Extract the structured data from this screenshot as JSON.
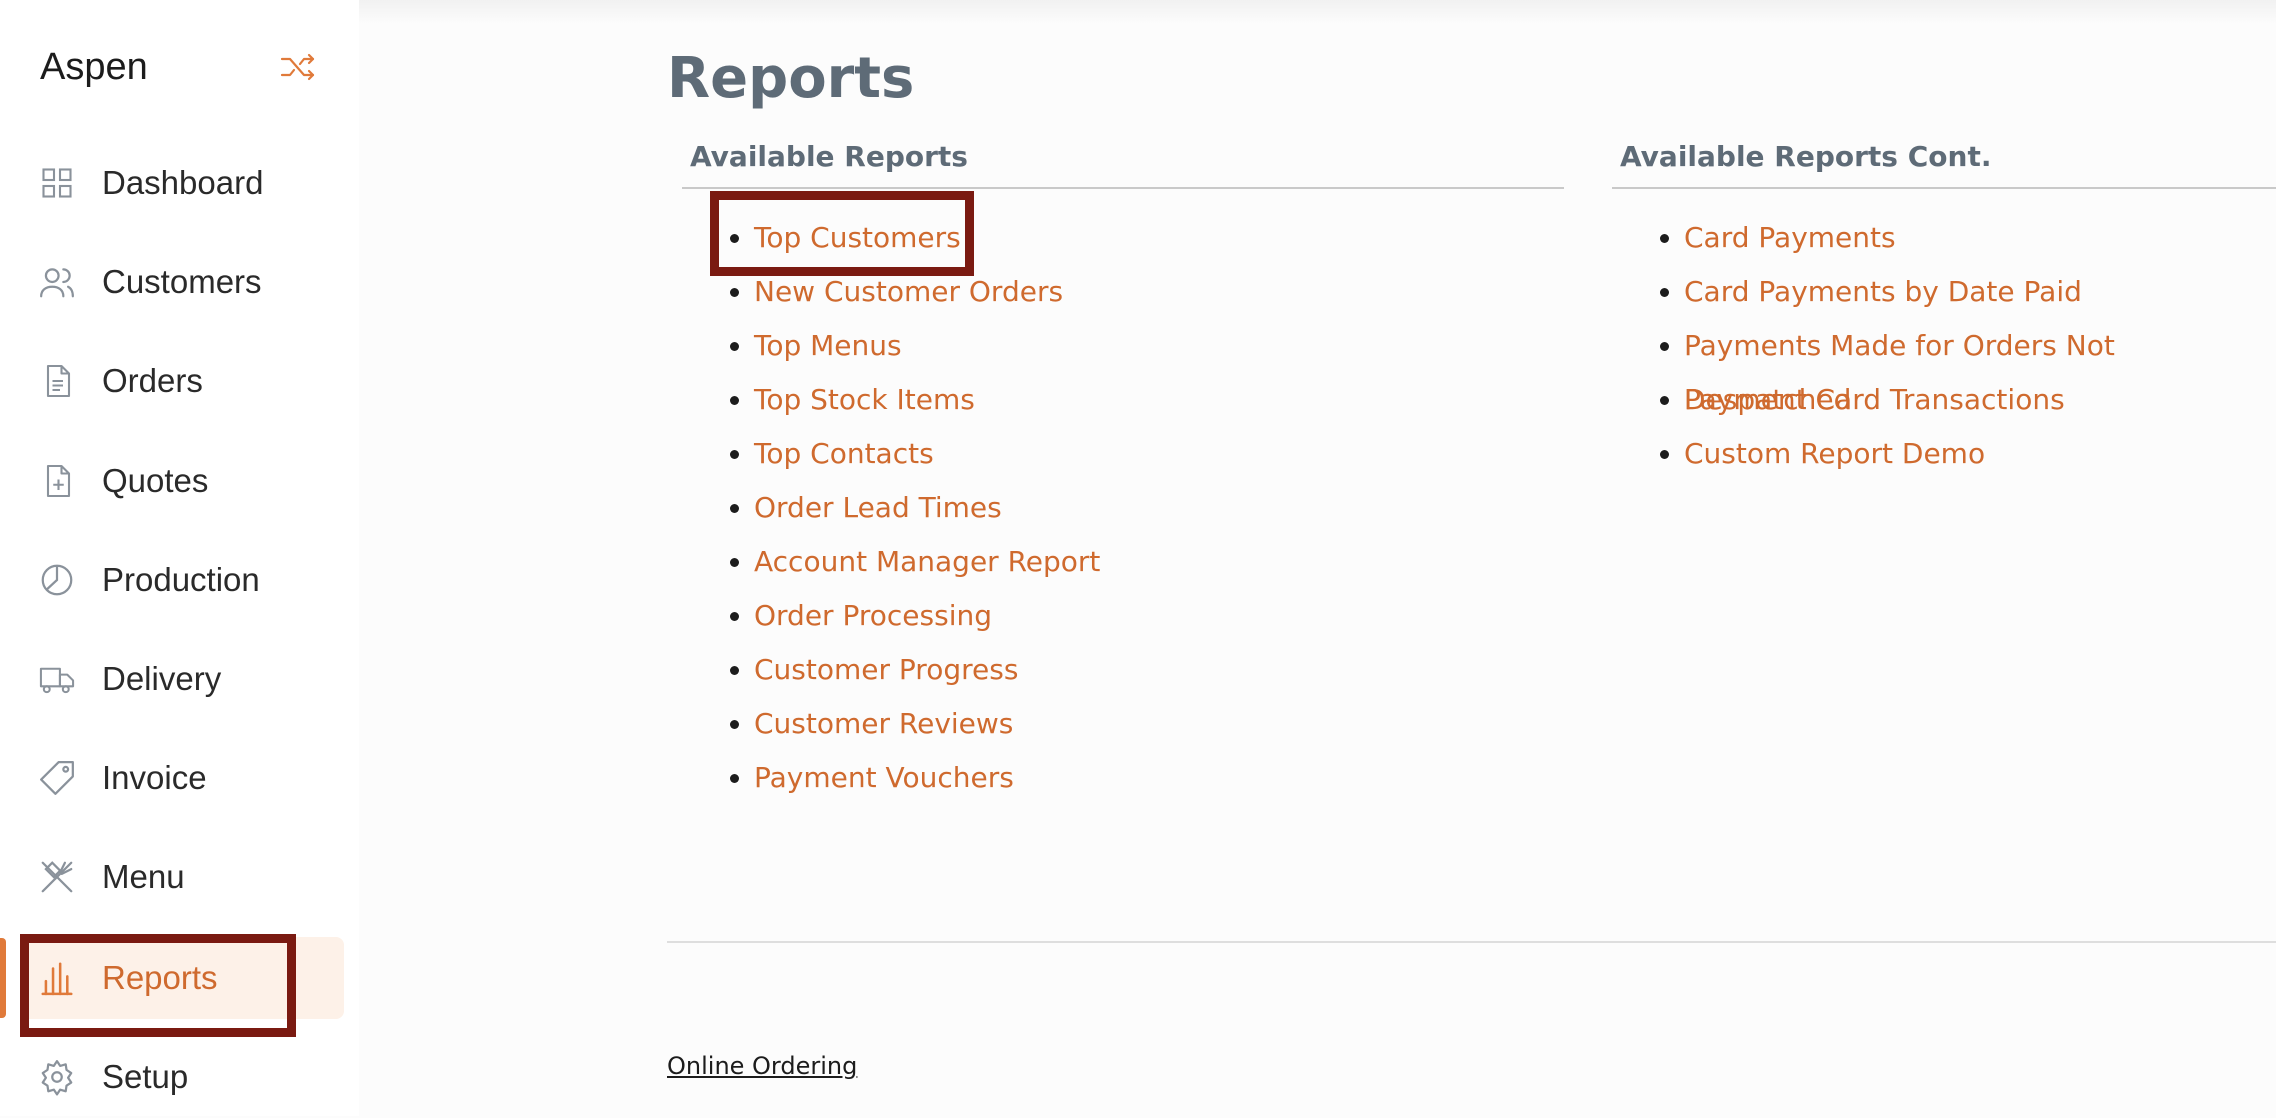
{
  "sidebar": {
    "brand": "Aspen",
    "items": [
      {
        "label": "Dashboard",
        "icon": "grid-icon"
      },
      {
        "label": "Customers",
        "icon": "users-icon"
      },
      {
        "label": "Orders",
        "icon": "document-icon"
      },
      {
        "label": "Quotes",
        "icon": "document-plus-icon"
      },
      {
        "label": "Production",
        "icon": "pie-chart-icon"
      },
      {
        "label": "Delivery",
        "icon": "truck-icon"
      },
      {
        "label": "Invoice",
        "icon": "tag-icon"
      },
      {
        "label": "Menu",
        "icon": "utensils-icon"
      },
      {
        "label": "Reports",
        "icon": "bar-chart-icon",
        "active": true
      },
      {
        "label": "Setup",
        "icon": "gear-icon"
      }
    ]
  },
  "main": {
    "title": "Reports",
    "left_column": {
      "heading": "Available Reports",
      "links": [
        "Top Customers",
        "New Customer Orders",
        "Top Menus",
        "Top Stock Items",
        "Top Contacts",
        "Order Lead Times",
        "Account Manager Report",
        "Order Processing",
        "Customer Progress",
        "Customer Reviews",
        "Payment Vouchers"
      ]
    },
    "right_column": {
      "heading": "Available Reports Cont.",
      "links": [
        "Card Payments",
        "Card Payments by Date Paid",
        "Payments Made for Orders Not Despatched",
        "Payment Card Transactions",
        "Custom Report Demo"
      ]
    },
    "footer_link": "Online Ordering"
  },
  "colors": {
    "accent": "#cf6a2e",
    "heading": "#5e6b77",
    "highlight": "#7a1a11",
    "active_bg": "#fdf1e8"
  }
}
